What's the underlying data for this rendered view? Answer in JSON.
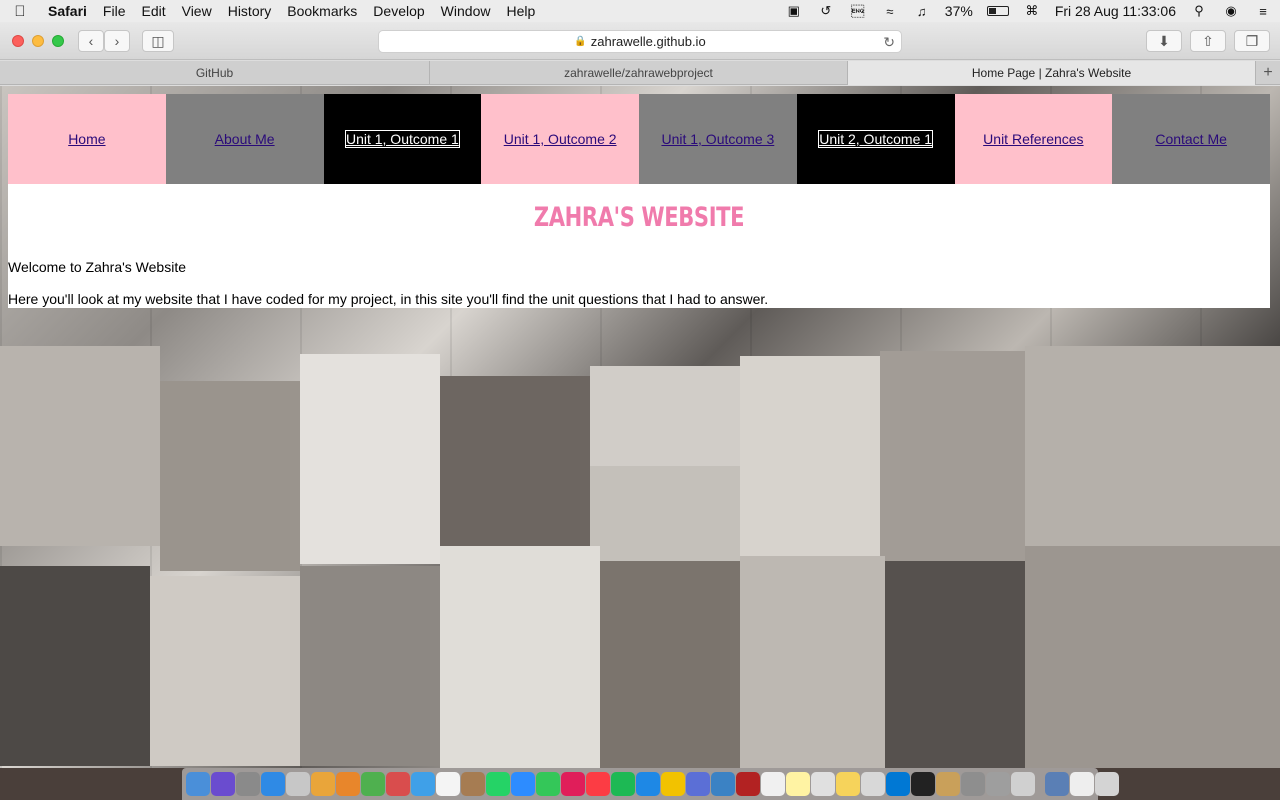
{
  "menubar": {
    "app": "Safari",
    "items": [
      "File",
      "Edit",
      "View",
      "History",
      "Bookmarks",
      "Develop",
      "Window",
      "Help"
    ],
    "battery": "37%",
    "datetime": "Fri 28 Aug  11:33:06"
  },
  "browser": {
    "url": "zahrawelle.github.io",
    "tabs": [
      {
        "label": "GitHub",
        "active": false
      },
      {
        "label": "zahrawelle/zahrawebproject",
        "active": false
      },
      {
        "label": "Home Page | Zahra's Website",
        "active": true
      }
    ]
  },
  "page": {
    "nav": [
      {
        "label": "Home",
        "bg": "#ffc0cb"
      },
      {
        "label": "About Me",
        "bg": "#808080"
      },
      {
        "label": "Unit 1, Outcome 1",
        "bg": "#000000"
      },
      {
        "label": "Unit 1, Outcome 2",
        "bg": "#ffc0cb"
      },
      {
        "label": "Unit 1, Outcome 3",
        "bg": "#808080"
      },
      {
        "label": "Unit 2, Outcome 1",
        "bg": "#000000"
      },
      {
        "label": "Unit References",
        "bg": "#ffc0cb"
      },
      {
        "label": "Contact Me",
        "bg": "#808080"
      }
    ],
    "title": "ZAHRA'S WEBSITE",
    "welcome": "Welcome to Zahra's Website",
    "intro": "Here you'll look at my website that I have coded for my project, in this site you'll find the unit questions that I had to answer."
  },
  "colors": {
    "title": "#f07bac",
    "link": "#2a0a7a"
  }
}
